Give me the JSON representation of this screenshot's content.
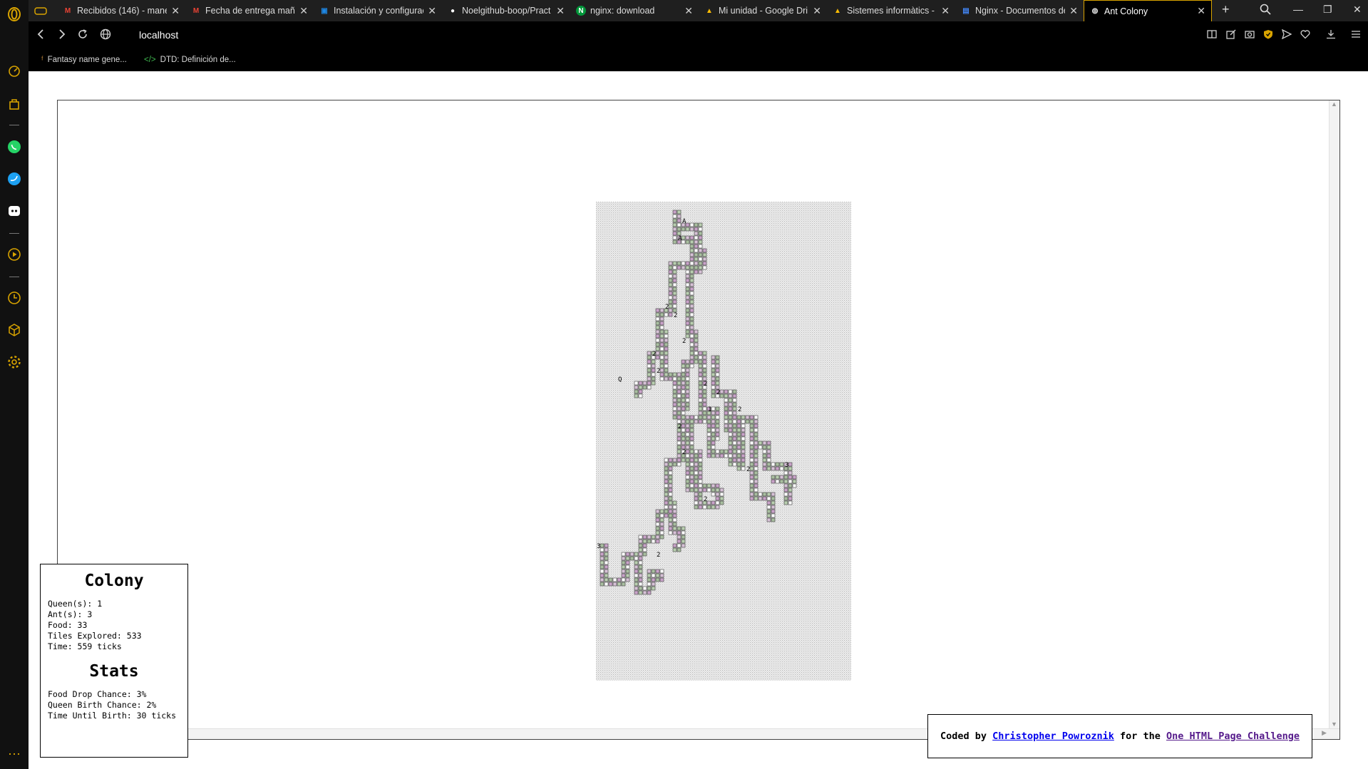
{
  "browser": {
    "tabs": [
      {
        "title": "Recibidos (146) - manel",
        "favicon": "gmail-icon",
        "fav_color": "#ea4335"
      },
      {
        "title": "Fecha de entrega maña",
        "favicon": "gmail-icon",
        "fav_color": "#ea4335"
      },
      {
        "title": "Instalación y configurac",
        "favicon": "classroom-icon",
        "fav_color": "#1e88e5"
      },
      {
        "title": "Noelgithub-boop/Pract",
        "favicon": "github-icon",
        "fav_color": "#ffffff"
      },
      {
        "title": "nginx: download",
        "favicon": "nginx-icon",
        "fav_color": "#009639"
      },
      {
        "title": "Mi unidad - Google Dri",
        "favicon": "drive-icon",
        "fav_color": "#fbbc04"
      },
      {
        "title": "Sistemes informàtics - G",
        "favicon": "drive-icon",
        "fav_color": "#fbbc04"
      },
      {
        "title": "Nginx - Documentos de",
        "favicon": "docs-icon",
        "fav_color": "#4285f4"
      },
      {
        "title": "Ant Colony",
        "favicon": "globe-icon",
        "fav_color": "#dcdcdc",
        "active": true
      }
    ],
    "url": "localhost",
    "bookmarks": [
      {
        "title": "Fantasy name gene..."
      },
      {
        "title": "DTD: Definición de..."
      }
    ],
    "accent_color": "#d8a300"
  },
  "colony": {
    "title": "Colony",
    "queens": "Queen(s): 1",
    "ants": "Ant(s): 3",
    "food": "Food: 33",
    "tiles": "Tiles Explored: 533",
    "time": "Time: 559 ticks"
  },
  "stats": {
    "title": "Stats",
    "food_drop": "Food Drop Chance: 3%",
    "queen_birth": "Queen Birth Chance: 2%",
    "until_birth": "Time Until Birth: 30 ticks"
  },
  "credit": {
    "prefix": "Coded by",
    "author": "Christopher Powroznik",
    "middle": "for the",
    "challenge": "One HTML Page Challenge"
  },
  "simulation": {
    "labels": [
      "A",
      "A",
      "2",
      "2",
      "2",
      "2",
      "2",
      "Q",
      "2",
      "2",
      "1",
      "2",
      "2",
      "2",
      "2",
      "2",
      "3",
      "2",
      "3"
    ]
  }
}
